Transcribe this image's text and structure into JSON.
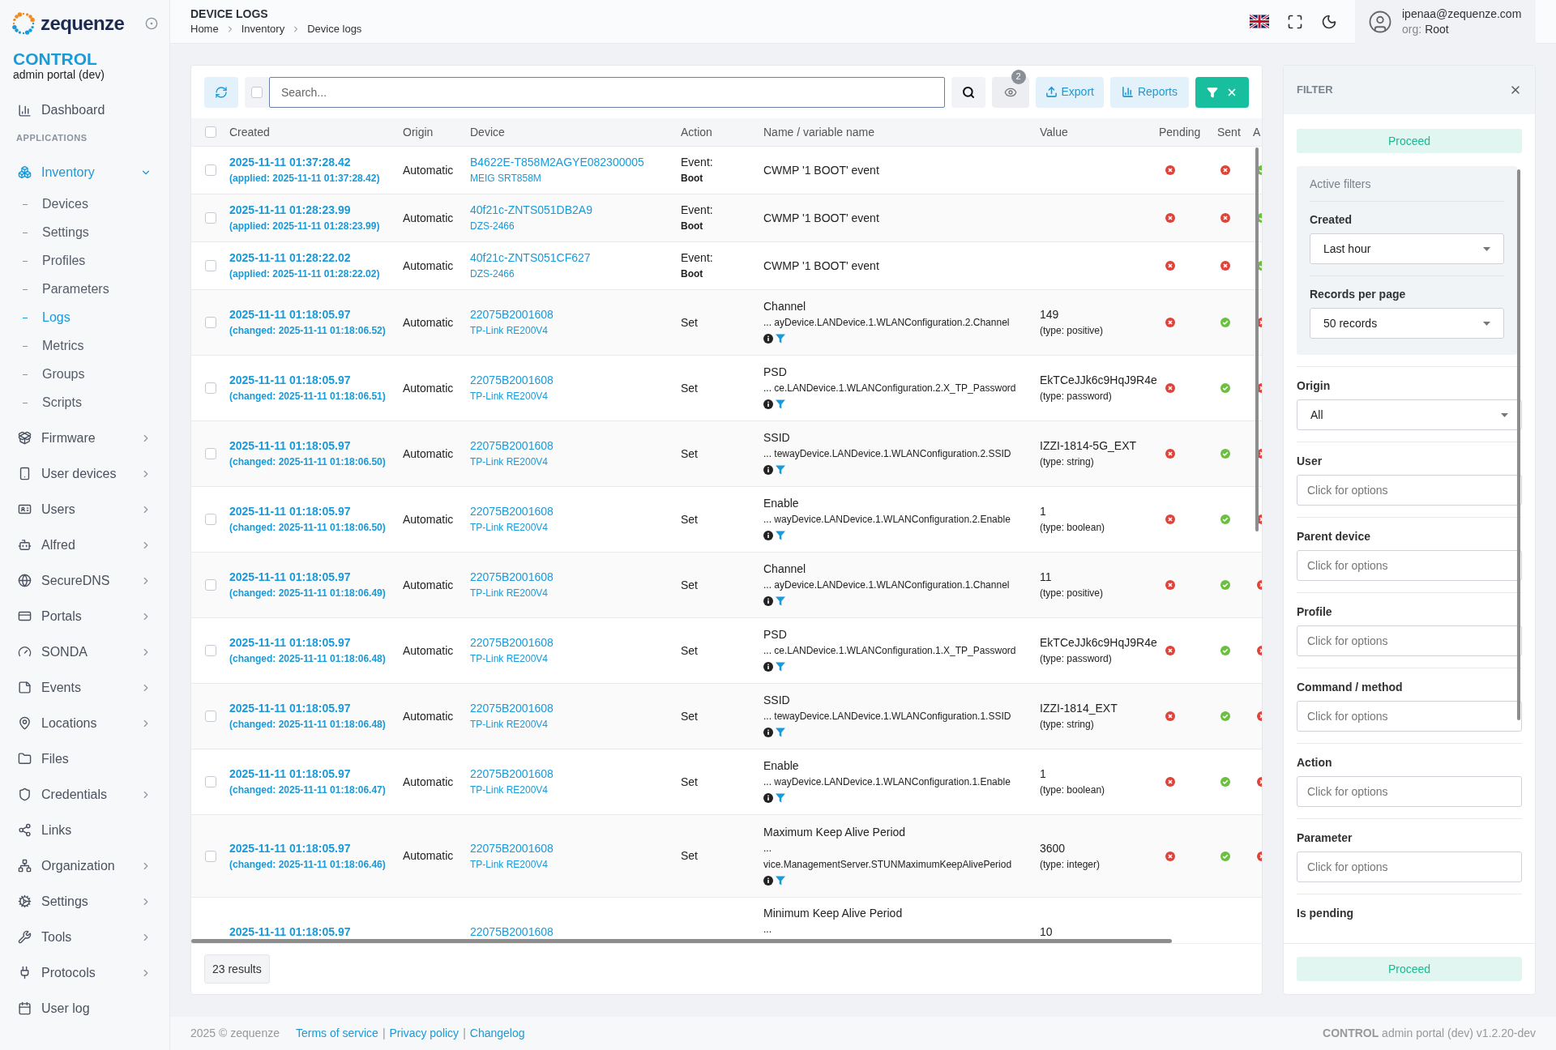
{
  "sidebar": {
    "brand": "zequenze",
    "product": "CONTROL",
    "subtitle": "admin portal (dev)",
    "top_items": [
      {
        "label": "Dashboard",
        "selected": false
      }
    ],
    "section_label": "APPLICATIONS",
    "items": [
      {
        "label": "Inventory",
        "expandable": true,
        "expanded": true,
        "selected": true,
        "children": [
          {
            "label": "Devices",
            "selected": false
          },
          {
            "label": "Settings",
            "selected": false
          },
          {
            "label": "Profiles",
            "selected": false
          },
          {
            "label": "Parameters",
            "selected": false
          },
          {
            "label": "Logs",
            "selected": true
          },
          {
            "label": "Metrics",
            "selected": false
          },
          {
            "label": "Groups",
            "selected": false
          },
          {
            "label": "Scripts",
            "selected": false
          }
        ]
      },
      {
        "label": "Firmware",
        "expandable": true,
        "expanded": false,
        "selected": false
      },
      {
        "label": "User devices",
        "expandable": true,
        "expanded": false,
        "selected": false
      },
      {
        "label": "Users",
        "expandable": true,
        "expanded": false,
        "selected": false
      },
      {
        "label": "Alfred",
        "expandable": true,
        "expanded": false,
        "selected": false
      },
      {
        "label": "SecureDNS",
        "expandable": true,
        "expanded": false,
        "selected": false
      },
      {
        "label": "Portals",
        "expandable": true,
        "expanded": false,
        "selected": false
      },
      {
        "label": "SONDA",
        "expandable": true,
        "expanded": false,
        "selected": false
      },
      {
        "label": "Events",
        "expandable": true,
        "expanded": false,
        "selected": false
      },
      {
        "label": "Locations",
        "expandable": true,
        "expanded": false,
        "selected": false
      },
      {
        "label": "Files",
        "expandable": false,
        "selected": false
      },
      {
        "label": "Credentials",
        "expandable": true,
        "expanded": false,
        "selected": false
      },
      {
        "label": "Links",
        "expandable": false,
        "selected": false
      },
      {
        "label": "Organization",
        "expandable": true,
        "expanded": false,
        "selected": false
      },
      {
        "label": "Settings",
        "expandable": true,
        "expanded": false,
        "selected": false
      },
      {
        "label": "Tools",
        "expandable": true,
        "expanded": false,
        "selected": false
      },
      {
        "label": "Protocols",
        "expandable": true,
        "expanded": false,
        "selected": false
      },
      {
        "label": "User log",
        "expandable": false,
        "selected": false
      }
    ]
  },
  "header": {
    "title": "DEVICE LOGS",
    "breadcrumb": [
      "Home",
      "Inventory",
      "Device logs"
    ],
    "user": {
      "email": "ipenaa@zequenze.com",
      "org_label": "org:",
      "org": "Root"
    }
  },
  "toolbar": {
    "select_all_checked": false,
    "search_placeholder": "Search...",
    "hidden_count": "2",
    "export": "Export",
    "reports": "Reports",
    "filter_open": true
  },
  "table": {
    "all_checked": false,
    "columns": [
      "Created",
      "Origin",
      "Device",
      "Action",
      "Name / variable name",
      "Value",
      "Pending",
      "Sent",
      "A"
    ],
    "rows": [
      {
        "kind": "event",
        "checked": false,
        "created": "2025-11-11 01:37:28.42",
        "changed": "(applied: 2025-11-11 01:37:28.42)",
        "origin": "Automatic",
        "device": "B4622E-T858M2AGYE082300005",
        "model": "MEIG SRT858M",
        "action": "Event:",
        "action_detail": "Boot",
        "name": "CWMP '1 BOOT' event",
        "pending": false,
        "sent": false,
        "column_9": true
      },
      {
        "kind": "event",
        "checked": false,
        "created": "2025-11-11 01:28:23.99",
        "changed": "(applied: 2025-11-11 01:28:23.99)",
        "origin": "Automatic",
        "device": "40f21c-ZNTS051DB2A9",
        "model": "DZS-2466",
        "action": "Event:",
        "action_detail": "Boot",
        "name": "CWMP '1 BOOT' event",
        "pending": false,
        "sent": false,
        "column_9": true
      },
      {
        "kind": "event",
        "checked": false,
        "created": "2025-11-11 01:28:22.02",
        "changed": "(applied: 2025-11-11 01:28:22.02)",
        "origin": "Automatic",
        "device": "40f21c-ZNTS051CF627",
        "model": "DZS-2466",
        "action": "Event:",
        "action_detail": "Boot",
        "name": "CWMP '1 BOOT' event",
        "pending": false,
        "sent": false,
        "column_9": true
      },
      {
        "kind": "parameter",
        "checked": false,
        "created": "2025-11-11 01:18:05.97",
        "changed": "(changed: 2025-11-11 01:18:06.52)",
        "origin": "Automatic",
        "device": "22075B2001608",
        "model": "TP-Link RE200V4",
        "action": "Set",
        "name": "Channel",
        "path": "... ayDevice.LANDevice.1.WLANConfiguration.2.Channel",
        "value": "149",
        "value_type": "(type: positive)",
        "pending": false,
        "sent": true,
        "column_9": false
      },
      {
        "kind": "parameter",
        "checked": false,
        "created": "2025-11-11 01:18:05.97",
        "changed": "(changed: 2025-11-11 01:18:06.51)",
        "origin": "Automatic",
        "device": "22075B2001608",
        "model": "TP-Link RE200V4",
        "action": "Set",
        "name": "PSD",
        "path": "... ce.LANDevice.1.WLANConfiguration.2.X_TP_Password",
        "value": "EkTCeJJk6c9HqJ9R4e",
        "value_type": "(type: password)",
        "pending": false,
        "sent": true,
        "column_9": false
      },
      {
        "kind": "parameter",
        "checked": false,
        "created": "2025-11-11 01:18:05.97",
        "changed": "(changed: 2025-11-11 01:18:06.50)",
        "origin": "Automatic",
        "device": "22075B2001608",
        "model": "TP-Link RE200V4",
        "action": "Set",
        "name": "SSID",
        "path": "... tewayDevice.LANDevice.1.WLANConfiguration.2.SSID",
        "value": "IZZI-1814-5G_EXT",
        "value_type": "(type: string)",
        "pending": false,
        "sent": true,
        "column_9": false
      },
      {
        "kind": "parameter",
        "checked": false,
        "created": "2025-11-11 01:18:05.97",
        "changed": "(changed: 2025-11-11 01:18:06.50)",
        "origin": "Automatic",
        "device": "22075B2001608",
        "model": "TP-Link RE200V4",
        "action": "Set",
        "name": "Enable",
        "path": "... wayDevice.LANDevice.1.WLANConfiguration.2.Enable",
        "value": "1",
        "value_type": "(type: boolean)",
        "pending": false,
        "sent": true,
        "column_9": false
      },
      {
        "kind": "parameter",
        "checked": false,
        "created": "2025-11-11 01:18:05.97",
        "changed": "(changed: 2025-11-11 01:18:06.49)",
        "origin": "Automatic",
        "device": "22075B2001608",
        "model": "TP-Link RE200V4",
        "action": "Set",
        "name": "Channel",
        "path": "... ayDevice.LANDevice.1.WLANConfiguration.1.Channel",
        "value": "11",
        "value_type": "(type: positive)",
        "pending": false,
        "sent": true,
        "column_9": false
      },
      {
        "kind": "parameter",
        "checked": false,
        "created": "2025-11-11 01:18:05.97",
        "changed": "(changed: 2025-11-11 01:18:06.48)",
        "origin": "Automatic",
        "device": "22075B2001608",
        "model": "TP-Link RE200V4",
        "action": "Set",
        "name": "PSD",
        "path": "... ce.LANDevice.1.WLANConfiguration.1.X_TP_Password",
        "value": "EkTCeJJk6c9HqJ9R4e",
        "value_type": "(type: password)",
        "pending": false,
        "sent": true,
        "column_9": false
      },
      {
        "kind": "parameter",
        "checked": false,
        "created": "2025-11-11 01:18:05.97",
        "changed": "(changed: 2025-11-11 01:18:06.48)",
        "origin": "Automatic",
        "device": "22075B2001608",
        "model": "TP-Link RE200V4",
        "action": "Set",
        "name": "SSID",
        "path": "... tewayDevice.LANDevice.1.WLANConfiguration.1.SSID",
        "value": "IZZI-1814_EXT",
        "value_type": "(type: string)",
        "pending": false,
        "sent": true,
        "column_9": false
      },
      {
        "kind": "parameter",
        "checked": false,
        "created": "2025-11-11 01:18:05.97",
        "changed": "(changed: 2025-11-11 01:18:06.47)",
        "origin": "Automatic",
        "device": "22075B2001608",
        "model": "TP-Link RE200V4",
        "action": "Set",
        "name": "Enable",
        "path": "... wayDevice.LANDevice.1.WLANConfiguration.1.Enable",
        "value": "1",
        "value_type": "(type: boolean)",
        "pending": false,
        "sent": true,
        "column_9": false
      },
      {
        "kind": "parameter",
        "checked": false,
        "created": "2025-11-11 01:18:05.97",
        "changed": "(changed: 2025-11-11 01:18:06.46)",
        "origin": "Automatic",
        "device": "22075B2001608",
        "model": "TP-Link RE200V4",
        "action": "Set",
        "name": "Maximum Keep Alive Period",
        "path": "... vice.ManagementServer.STUNMaximumKeepAlivePeriod",
        "path_wrapped": true,
        "value": "3600",
        "value_type": "(type: integer)",
        "pending": false,
        "sent": true,
        "column_9": false
      },
      {
        "kind": "partial",
        "created": "2025-11-11 01:18:05.97",
        "device": "22075B2001608",
        "name": "Minimum Keep Alive Period",
        "path": "...",
        "value": "10"
      }
    ],
    "results": "23 results"
  },
  "filter": {
    "title": "FILTER",
    "proceed_top": "Proceed",
    "active_title": "Active filters",
    "active": [
      {
        "label": "Created",
        "value": "Last hour"
      },
      {
        "label": "Records per page",
        "value": "50 records"
      }
    ],
    "fields": [
      {
        "label": "Origin",
        "kind": "select",
        "value": "All"
      },
      {
        "label": "User",
        "kind": "options",
        "placeholder": "Click for options"
      },
      {
        "label": "Parent device",
        "kind": "options",
        "placeholder": "Click for options"
      },
      {
        "label": "Profile",
        "kind": "options",
        "placeholder": "Click for options"
      },
      {
        "label": "Command / method",
        "kind": "options",
        "placeholder": "Click for options"
      },
      {
        "label": "Action",
        "kind": "options",
        "placeholder": "Click for options"
      },
      {
        "label": "Parameter",
        "kind": "options",
        "placeholder": "Click for options"
      },
      {
        "label": "Is pending",
        "kind": "cut"
      }
    ],
    "proceed_bottom": "Proceed"
  },
  "footer": {
    "copyright": "2025 © zequenze",
    "links": [
      "Terms of service",
      "Privacy policy",
      "Changelog"
    ],
    "separator": "|",
    "version": "**CONTROL** admin portal (dev) v1.2.20-dev"
  }
}
